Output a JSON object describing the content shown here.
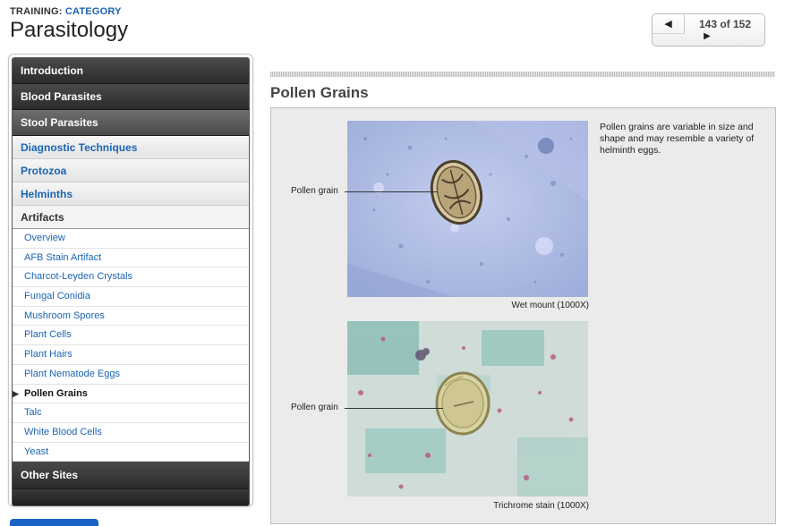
{
  "header": {
    "kicker_prefix": "TRAINING:",
    "kicker_category": "CATEGORY",
    "title": "Parasitology"
  },
  "pager": {
    "prev_icon": "◀",
    "count_label": "143 of 152",
    "next_icon": "▶"
  },
  "sidebar": {
    "top_items": [
      {
        "label": "Introduction"
      },
      {
        "label": "Blood Parasites"
      },
      {
        "label": "Stool Parasites"
      }
    ],
    "stool_sections": [
      {
        "label": "Diagnostic Techniques"
      },
      {
        "label": "Protozoa"
      },
      {
        "label": "Helminths"
      },
      {
        "label": "Artifacts"
      }
    ],
    "artifacts": [
      {
        "label": "Overview"
      },
      {
        "label": "AFB Stain Artifact"
      },
      {
        "label": "Charcot-Leyden Crystals"
      },
      {
        "label": "Fungal Conidia"
      },
      {
        "label": "Mushroom Spores"
      },
      {
        "label": "Plant Cells"
      },
      {
        "label": "Plant Hairs"
      },
      {
        "label": "Plant Nematode Eggs"
      },
      {
        "label": "Pollen Grains"
      },
      {
        "label": "Talc"
      },
      {
        "label": "White Blood Cells"
      },
      {
        "label": "Yeast"
      }
    ],
    "selected_marker": "▶",
    "other_sites": "Other Sites"
  },
  "content": {
    "section_title": "Pollen Grains",
    "description": "Pollen grains are variable in size and shape and may resemble a variety of helminth eggs.",
    "figures": [
      {
        "callout": "Pollen grain",
        "caption": "Wet mount (1000X)"
      },
      {
        "callout": "Pollen grain",
        "caption": "Trichrome stain (1000X)"
      }
    ]
  },
  "colors": {
    "link": "#1b64b3",
    "nav_dark": "#2b2b2b",
    "panel_bg": "#ebebeb",
    "bottom_button": "#1a63c4"
  }
}
